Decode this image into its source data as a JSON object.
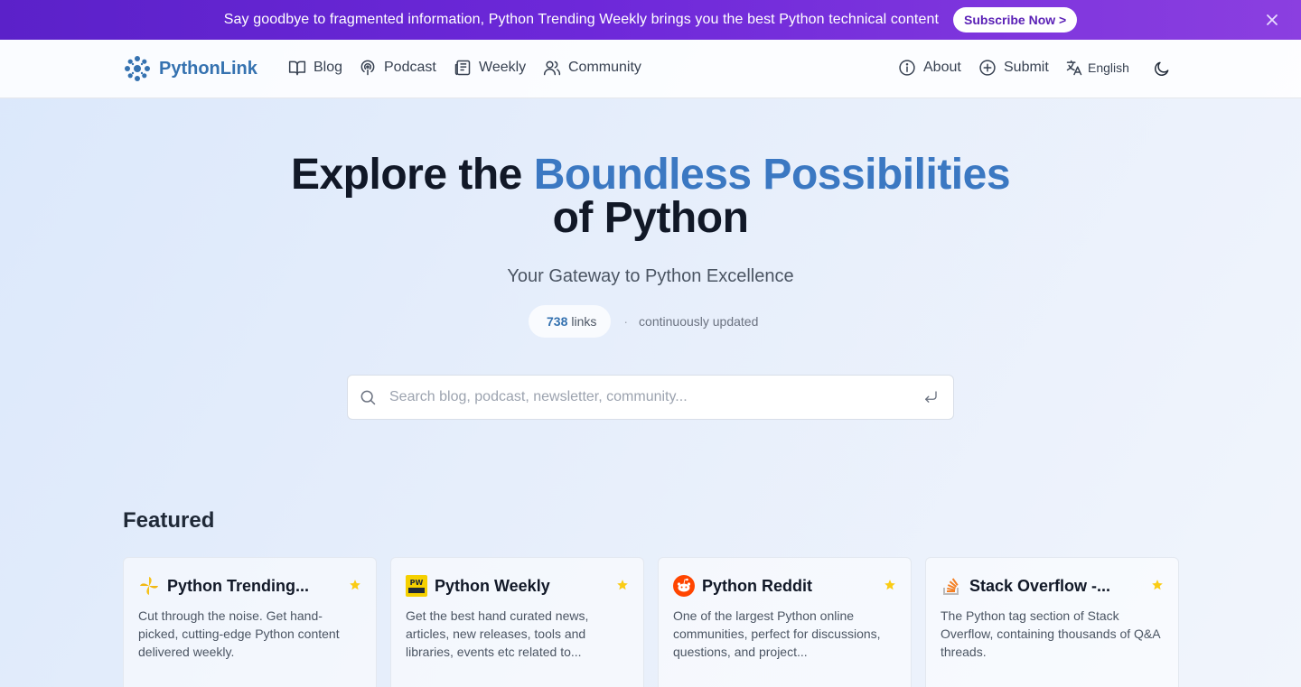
{
  "announcement": {
    "text": "Say goodbye to fragmented information, Python Trending Weekly brings you the best Python technical content",
    "button_label": "Subscribe Now >",
    "colors": {
      "start": "#5b21c9",
      "end": "#8b3fe0"
    },
    "close_icon": "close-icon"
  },
  "header": {
    "logo_text": "PythonLink",
    "nav": [
      {
        "label": "Blog",
        "icon": "book-icon"
      },
      {
        "label": "Podcast",
        "icon": "podcast-icon"
      },
      {
        "label": "Weekly",
        "icon": "newspaper-icon"
      },
      {
        "label": "Community",
        "icon": "users-icon"
      }
    ],
    "right": [
      {
        "label": "About",
        "icon": "info-icon"
      },
      {
        "label": "Submit",
        "icon": "plus-circle-icon"
      },
      {
        "label": "English",
        "icon": "translate-icon"
      }
    ],
    "theme_icon": "moon-icon"
  },
  "hero": {
    "title_start": "Explore the",
    "title_accent": "Boundless Possibilities",
    "title_end": "of Python",
    "subtitle": "Your Gateway to Python Excellence",
    "stats": {
      "count": "738",
      "unit": "links",
      "separator": "·",
      "updated": "continuously updated"
    },
    "accent_color": "#3b78c2"
  },
  "search": {
    "placeholder": "Search blog, podcast, newsletter, community...",
    "value": ""
  },
  "featured": {
    "title": "Featured",
    "cards": [
      {
        "title": "Python Trending...",
        "description": "Cut through the noise. Get hand-picked, cutting-edge Python content delivered weekly.",
        "icon": "pinwheel-logo-icon",
        "starred": true
      },
      {
        "title": "Python Weekly",
        "description": "Get the best hand curated news, articles, new releases, tools and libraries, events etc related to...",
        "icon": "python-weekly-logo-icon",
        "starred": true
      },
      {
        "title": "Python Reddit",
        "description": "One of the largest Python online communities, perfect for discussions, questions, and project...",
        "icon": "reddit-logo-icon",
        "starred": true
      },
      {
        "title": "Stack Overflow -...",
        "description": "The Python tag section of Stack Overflow, containing thousands of Q&A threads.",
        "icon": "stackoverflow-logo-icon",
        "starred": true
      }
    ],
    "star_color": "#facc15"
  }
}
